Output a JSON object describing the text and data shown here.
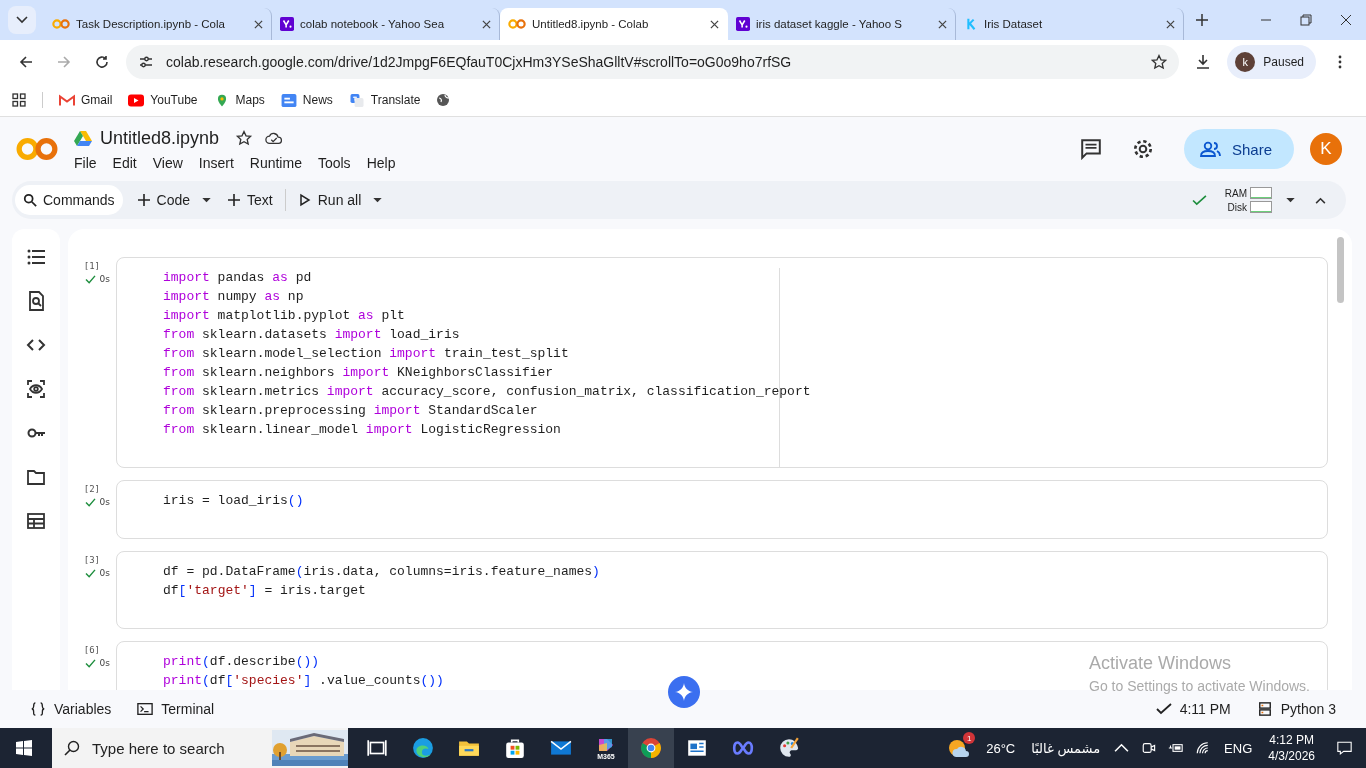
{
  "browser": {
    "tabs": [
      {
        "title": "Task Description.ipynb - Cola",
        "kind": "colab",
        "selected": false
      },
      {
        "title": "colab notebook - Yahoo Sea",
        "kind": "yahoo",
        "selected": false
      },
      {
        "title": "Untitled8.ipynb - Colab",
        "kind": "colab",
        "selected": true
      },
      {
        "title": "iris dataset kaggle - Yahoo S",
        "kind": "yahoo",
        "selected": false
      },
      {
        "title": "Iris Dataset",
        "kind": "kaggle",
        "selected": false
      }
    ],
    "url": "colab.research.google.com/drive/1d2JmpgF6EQfauT0CjxHm3YSeShaGlltV#scrollTo=oG0o9ho7rfSG",
    "profile": {
      "initial": "k",
      "label": "Paused"
    },
    "bookmarks": [
      {
        "label": "Gmail",
        "kind": "gmail"
      },
      {
        "label": "YouTube",
        "kind": "youtube"
      },
      {
        "label": "Maps",
        "kind": "maps"
      },
      {
        "label": "News",
        "kind": "news"
      },
      {
        "label": "Translate",
        "kind": "translate"
      }
    ]
  },
  "colab": {
    "title": "Untitled8.ipynb",
    "menu": [
      "File",
      "Edit",
      "View",
      "Insert",
      "Runtime",
      "Tools",
      "Help"
    ],
    "share": "Share",
    "avatar": "K",
    "toolbar": {
      "commands": "Commands",
      "code": "Code",
      "text": "Text",
      "run_all": "Run all",
      "ram": "RAM",
      "disk": "Disk"
    },
    "cells": [
      {
        "number": "[1]",
        "time": "0s",
        "ruler": true,
        "lines": [
          [
            {
              "kind": "keyword",
              "text": "import"
            },
            {
              "kind": "plain",
              "text": " pandas "
            },
            {
              "kind": "keyword",
              "text": "as"
            },
            {
              "kind": "plain",
              "text": " pd"
            }
          ],
          [
            {
              "kind": "keyword",
              "text": "import"
            },
            {
              "kind": "plain",
              "text": " numpy "
            },
            {
              "kind": "keyword",
              "text": "as"
            },
            {
              "kind": "plain",
              "text": " np"
            }
          ],
          [
            {
              "kind": "keyword",
              "text": "import"
            },
            {
              "kind": "plain",
              "text": " matplotlib.pyplot "
            },
            {
              "kind": "keyword",
              "text": "as"
            },
            {
              "kind": "plain",
              "text": " plt"
            }
          ],
          [
            {
              "kind": "keyword",
              "text": "from"
            },
            {
              "kind": "plain",
              "text": " sklearn.datasets "
            },
            {
              "kind": "keyword",
              "text": "import"
            },
            {
              "kind": "plain",
              "text": " load_iris"
            }
          ],
          [
            {
              "kind": "keyword",
              "text": "from"
            },
            {
              "kind": "plain",
              "text": " sklearn.model_selection "
            },
            {
              "kind": "keyword",
              "text": "import"
            },
            {
              "kind": "plain",
              "text": " train_test_split"
            }
          ],
          [
            {
              "kind": "keyword",
              "text": "from"
            },
            {
              "kind": "plain",
              "text": " sklearn.neighbors "
            },
            {
              "kind": "keyword",
              "text": "import"
            },
            {
              "kind": "plain",
              "text": " KNeighborsClassifier"
            }
          ],
          [
            {
              "kind": "keyword",
              "text": "from"
            },
            {
              "kind": "plain",
              "text": " sklearn.metrics "
            },
            {
              "kind": "keyword",
              "text": "import"
            },
            {
              "kind": "plain",
              "text": " accuracy_score, confusion_matrix, classification_report"
            }
          ],
          [
            {
              "kind": "keyword",
              "text": "from"
            },
            {
              "kind": "plain",
              "text": " sklearn.preprocessing "
            },
            {
              "kind": "keyword",
              "text": "import"
            },
            {
              "kind": "plain",
              "text": " StandardScaler"
            }
          ],
          [
            {
              "kind": "keyword",
              "text": "from"
            },
            {
              "kind": "plain",
              "text": " sklearn.linear_model "
            },
            {
              "kind": "keyword",
              "text": "import"
            },
            {
              "kind": "plain",
              "text": " LogisticRegression"
            }
          ]
        ]
      },
      {
        "number": "[2]",
        "time": "0s",
        "ruler": false,
        "lines": [
          [
            {
              "kind": "plain",
              "text": "iris = load_iris"
            },
            {
              "kind": "bracket",
              "text": "()"
            }
          ]
        ]
      },
      {
        "number": "[3]",
        "time": "0s",
        "ruler": false,
        "lines": [
          [
            {
              "kind": "plain",
              "text": "df = pd.DataFrame"
            },
            {
              "kind": "bracket",
              "text": "("
            },
            {
              "kind": "plain",
              "text": "iris.data, columns=iris.feature_names"
            },
            {
              "kind": "bracket",
              "text": ")"
            }
          ],
          [
            {
              "kind": "plain",
              "text": "df"
            },
            {
              "kind": "bracket",
              "text": "["
            },
            {
              "kind": "string",
              "text": "'target'"
            },
            {
              "kind": "bracket",
              "text": "]"
            },
            {
              "kind": "plain",
              "text": " = iris.target"
            }
          ]
        ]
      },
      {
        "number": "[6]",
        "time": "0s",
        "ruler": false,
        "lines": [
          [
            {
              "kind": "keyword",
              "text": "print"
            },
            {
              "kind": "bracket",
              "text": "("
            },
            {
              "kind": "plain",
              "text": "df.describe"
            },
            {
              "kind": "bracket",
              "text": "())"
            }
          ],
          [
            {
              "kind": "keyword",
              "text": "print"
            },
            {
              "kind": "bracket",
              "text": "("
            },
            {
              "kind": "plain",
              "text": "df"
            },
            {
              "kind": "bracket",
              "text": "["
            },
            {
              "kind": "string",
              "text": "'species'"
            },
            {
              "kind": "bracket",
              "text": "]"
            },
            {
              "kind": "plain",
              "text": " .value_counts"
            },
            {
              "kind": "bracket",
              "text": "())"
            }
          ]
        ]
      }
    ],
    "status": {
      "variables": "Variables",
      "terminal": "Terminal",
      "saved": "4:11 PM",
      "runtime": "Python 3"
    }
  },
  "activation": {
    "title": "Activate Windows",
    "subtitle": "Go to Settings to activate Windows."
  },
  "taskbar": {
    "search": "Type here to search",
    "m365": "M365",
    "weather": {
      "badge": "1",
      "temp": "26°C",
      "condition": "مشمس غالبًا"
    },
    "language": "ENG",
    "time": "4:12 PM",
    "date": "4/3/2026"
  }
}
